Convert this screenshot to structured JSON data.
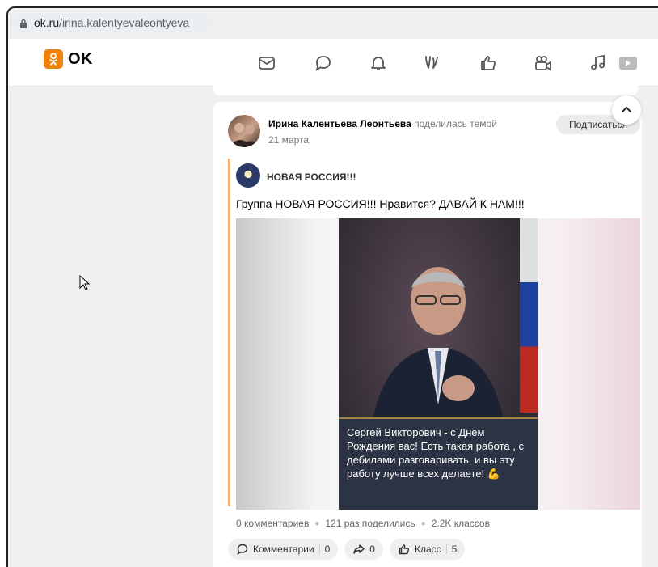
{
  "browser": {
    "host": "ok.ru",
    "path": "/irina.kalentyevaleontyeva"
  },
  "header": {
    "logo_text": "OK",
    "brand_color": "#ee8208",
    "nav_icons": [
      "mail-icon",
      "chat-icon",
      "bell-icon",
      "guests-icon",
      "like-icon",
      "video-icon",
      "music-icon",
      "play-icon"
    ]
  },
  "post": {
    "author": "Ирина Калентьева Леонтьева",
    "action": "поделилась темой",
    "date": "21 марта",
    "subscribe_label": "Подписаться",
    "group_name": "НОВАЯ РОССИЯ!!!",
    "text": "Группа НОВАЯ РОССИЯ!!! Нравится? ДАВАЙ К НАМ!!!",
    "image_caption": "Сергей Викторович -  с Днем Рождения вас!  Есть такая работа , с дебилами разговаривать, и вы эту работу лучше всех делаете! 💪",
    "stats": {
      "comments": "0 комментариев",
      "shares": "121 раз поделились",
      "likes": "2.2K классов"
    },
    "actions": {
      "comment_label": "Комментарии",
      "comment_count": "0",
      "share_count": "0",
      "like_label": "Класс",
      "like_count": "5"
    }
  }
}
